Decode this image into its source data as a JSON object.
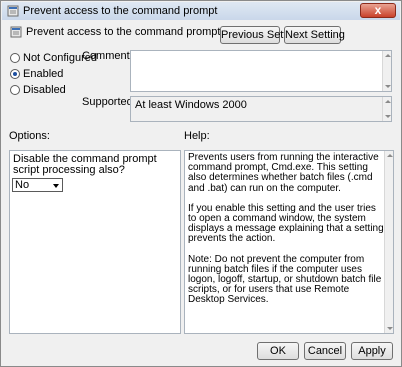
{
  "window": {
    "title": "Prevent access to the command prompt",
    "close_glyph": "x"
  },
  "header": {
    "policy_name": "Prevent access to the command prompt",
    "prev_button": "Previous Setting",
    "next_button": "Next Setting"
  },
  "state": {
    "options": [
      {
        "label": "Not Configured",
        "checked": false
      },
      {
        "label": "Enabled",
        "checked": true
      },
      {
        "label": "Disabled",
        "checked": false
      }
    ]
  },
  "comment": {
    "label": "Comment:",
    "value": ""
  },
  "supported": {
    "label": "Supported on:",
    "value": "At least Windows 2000"
  },
  "options_section": {
    "label": "Options:",
    "setting_text": "Disable the command prompt script processing also?",
    "select_value": "No"
  },
  "help_section": {
    "label": "Help:",
    "paragraphs": [
      "Prevents users from running the interactive command prompt, Cmd.exe. This setting also determines whether batch files (.cmd and .bat) can run on the computer.",
      "If you enable this setting and the user tries to open a command window, the system displays a message explaining that a setting prevents the action.",
      "Note: Do not prevent the computer from running batch files if the computer uses logon, logoff, startup, or shutdown batch file scripts, or for users that use Remote Desktop Services."
    ]
  },
  "footer": {
    "ok": "OK",
    "cancel": "Cancel",
    "apply": "Apply"
  },
  "icons": {
    "title": "policy-icon",
    "header": "policy-icon",
    "close": "close-icon"
  }
}
